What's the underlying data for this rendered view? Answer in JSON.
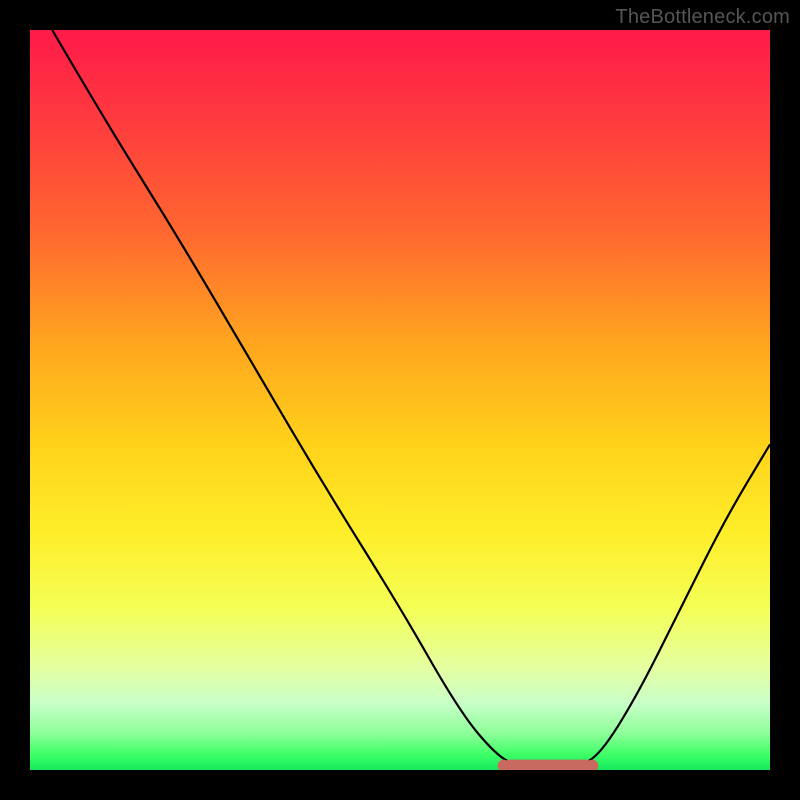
{
  "watermark": "TheBottleneck.com",
  "chart_data": {
    "type": "line",
    "title": "",
    "xlabel": "",
    "ylabel": "",
    "xlim": [
      0,
      100
    ],
    "ylim": [
      0,
      100
    ],
    "grid": false,
    "legend": false,
    "series": [
      {
        "name": "curve",
        "points": [
          {
            "x": 3,
            "y": 100
          },
          {
            "x": 10,
            "y": 88
          },
          {
            "x": 20,
            "y": 72
          },
          {
            "x": 30,
            "y": 55
          },
          {
            "x": 40,
            "y": 38
          },
          {
            "x": 50,
            "y": 22
          },
          {
            "x": 58,
            "y": 8
          },
          {
            "x": 63,
            "y": 2
          },
          {
            "x": 66,
            "y": 0.5
          },
          {
            "x": 70,
            "y": 0.3
          },
          {
            "x": 74,
            "y": 0.5
          },
          {
            "x": 77,
            "y": 2
          },
          {
            "x": 82,
            "y": 10
          },
          {
            "x": 88,
            "y": 22
          },
          {
            "x": 94,
            "y": 34
          },
          {
            "x": 100,
            "y": 44
          }
        ]
      }
    ],
    "highlight_range": {
      "x_start": 64,
      "x_end": 76
    },
    "gradient": {
      "direction": "vertical",
      "stops": [
        {
          "pos": 0,
          "color": "#ff1a4a"
        },
        {
          "pos": 50,
          "color": "#ffd21a"
        },
        {
          "pos": 100,
          "color": "#14e85e"
        }
      ]
    }
  }
}
